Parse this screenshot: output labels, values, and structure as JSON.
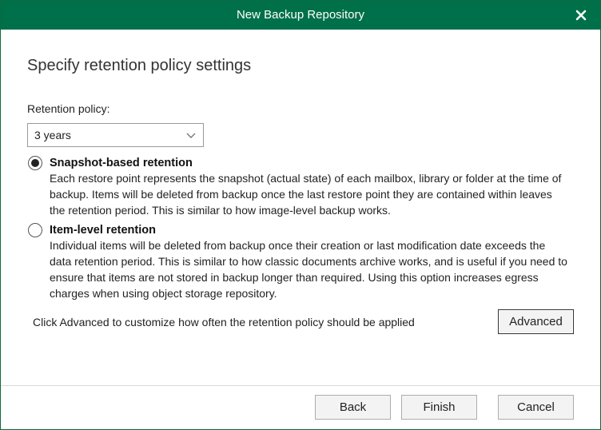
{
  "window": {
    "title": "New Backup Repository"
  },
  "page": {
    "heading": "Specify retention policy settings"
  },
  "retention": {
    "label": "Retention policy:",
    "selected_value": "3 years"
  },
  "options": {
    "snapshot": {
      "title": "Snapshot-based retention",
      "selected": true,
      "description": "Each restore point represents the snapshot (actual state) of each mailbox, library or folder at the time of backup. Items will be deleted from backup once the last restore point they are contained within leaves the retention period. This is similar to how image-level backup works."
    },
    "item_level": {
      "title": "Item-level retention",
      "selected": false,
      "description": "Individual items will be deleted from backup once their creation or last modification date exceeds the data retention period. This is similar to how classic documents archive works, and is useful if you need to ensure that items are not stored in backup longer than required. Using this option increases egress charges when using object storage repository."
    }
  },
  "advanced": {
    "hint": "Click Advanced to customize how often the retention policy should be applied",
    "button_label": "Advanced"
  },
  "footer": {
    "back_label": "Back",
    "finish_label": "Finish",
    "cancel_label": "Cancel"
  },
  "colors": {
    "titlebar": "#00704a",
    "title_text": "#ffffff"
  },
  "icons": {
    "close": "close-icon",
    "dropdown": "chevron-down-icon"
  }
}
